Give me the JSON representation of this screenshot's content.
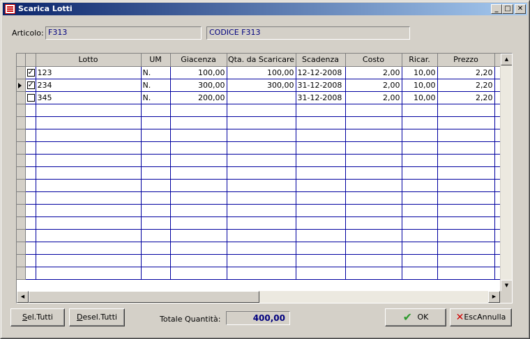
{
  "window": {
    "title": "Scarica Lotti",
    "min": "_",
    "max": "□",
    "close": "✕"
  },
  "articolo": {
    "label": "Articolo:",
    "code": "F313",
    "description": "CODICE F313"
  },
  "grid": {
    "columns": [
      "Lotto",
      "UM",
      "Giacenza",
      "Qta. da Scaricare",
      "Scadenza",
      "Costo",
      "Ricar.",
      "Prezzo"
    ],
    "rows": [
      {
        "checked": true,
        "current": false,
        "lotto": "123",
        "um": "N.",
        "giacenza": "100,00",
        "qta": "100,00",
        "scadenza": "12-12-2008",
        "costo": "2,00",
        "ricar": "10,00",
        "prezzo": "2,20"
      },
      {
        "checked": true,
        "current": true,
        "lotto": "234",
        "um": "N.",
        "giacenza": "300,00",
        "qta": "300,00",
        "scadenza": "31-12-2008",
        "costo": "2,00",
        "ricar": "10,00",
        "prezzo": "2,20"
      },
      {
        "checked": false,
        "current": false,
        "lotto": "345",
        "um": "N.",
        "giacenza": "200,00",
        "qta": "",
        "scadenza": "31-12-2008",
        "costo": "2,00",
        "ricar": "10,00",
        "prezzo": "2,20"
      }
    ],
    "empty_rows": 14
  },
  "buttons": {
    "sel_tutti": {
      "accel": "S",
      "rest": "el.Tutti"
    },
    "desel_tutti": {
      "accel": "D",
      "rest": "esel.Tutti"
    },
    "ok": "OK",
    "annulla_prefix": "Esc",
    "annulla": "Annulla"
  },
  "totale": {
    "label": "Totale Quantità:",
    "value": "400,00"
  },
  "colors": {
    "accent": "#0a246a",
    "value_text": "#00007f",
    "ok_check": "#2e9a2e",
    "cancel_x": "#d00000"
  }
}
